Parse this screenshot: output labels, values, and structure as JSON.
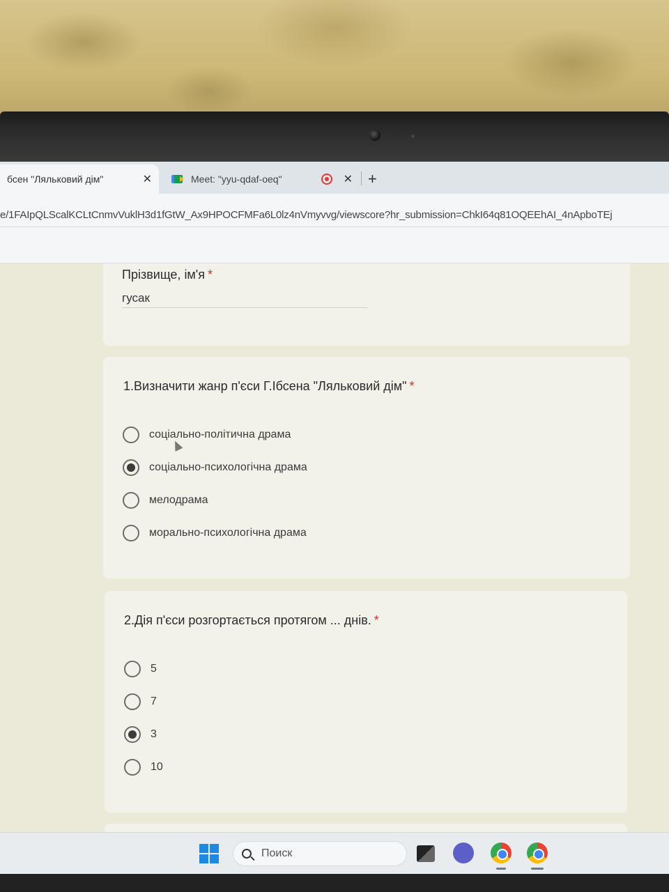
{
  "browser": {
    "tabs": [
      {
        "label": "бсен \"Ляльковий дім\"",
        "close": "✕"
      },
      {
        "label": "Meet: \"yyu-qdaf-oeq\"",
        "close": "✕"
      }
    ],
    "new_tab": "+",
    "url": "e/1FAIpQLScalKCLtCnmvVuklH3d1fGtW_Ax9HPOCFMFa6L0lz4nVmyvvg/viewscore?hr_submission=ChkI64q81OQEEhAI_4nApboTEj"
  },
  "form": {
    "name_question": {
      "label": "Прізвище, ім'я",
      "required": "*",
      "value": "гусак"
    },
    "q1": {
      "title": "1.Визначити жанр п'єси Г.Ібсена \"Ляльковий дім\"",
      "required": "*",
      "options": [
        {
          "label": "соціально-політична драма",
          "selected": false
        },
        {
          "label": "соціально-психологічна драма",
          "selected": true
        },
        {
          "label": "мелодрама",
          "selected": false
        },
        {
          "label": "морально-психологічна драма",
          "selected": false
        }
      ]
    },
    "q2": {
      "title": "2.Дія п'єси розгортається протягом ... днів.",
      "required": "*",
      "options": [
        {
          "label": "5",
          "selected": false
        },
        {
          "label": "7",
          "selected": false
        },
        {
          "label": "3",
          "selected": true
        },
        {
          "label": "10",
          "selected": false
        }
      ]
    }
  },
  "taskbar": {
    "search_placeholder": "Поиск",
    "icons": [
      "windows-start-icon",
      "search-icon",
      "task-view-icon",
      "chat-icon",
      "chrome-icon",
      "chrome-icon"
    ]
  },
  "colors": {
    "required_star": "#d93025",
    "page_bg": "#ebe9d8",
    "card_bg": "#f2f1ea"
  }
}
